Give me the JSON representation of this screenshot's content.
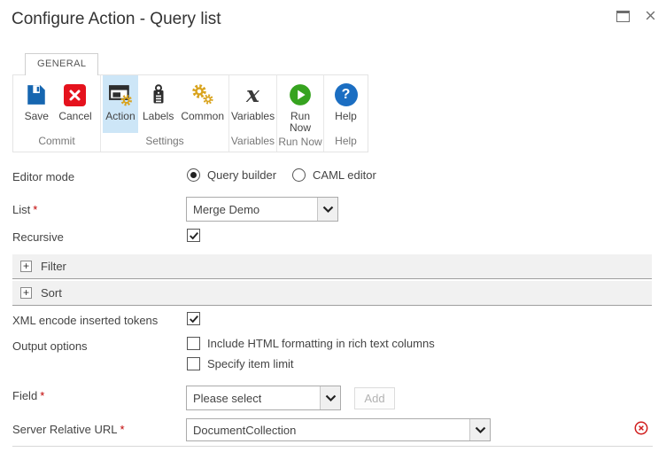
{
  "window": {
    "title": "Configure Action - Query list"
  },
  "tab": {
    "label": "GENERAL"
  },
  "ribbon": {
    "groups": [
      {
        "label": "Commit",
        "buttons": [
          {
            "label": "Save"
          },
          {
            "label": "Cancel"
          }
        ]
      },
      {
        "label": "Settings",
        "buttons": [
          {
            "label": "Action",
            "selected": true
          },
          {
            "label": "Labels"
          },
          {
            "label": "Common"
          }
        ]
      },
      {
        "label": "Variables",
        "buttons": [
          {
            "label": "Variables"
          }
        ]
      },
      {
        "label": "Run Now",
        "buttons": [
          {
            "label": "Run Now"
          }
        ]
      },
      {
        "label": "Help",
        "buttons": [
          {
            "label": "Help"
          }
        ]
      }
    ]
  },
  "icons": {
    "variables_glyph": "x",
    "help_glyph": "?",
    "expand_glyph": "+"
  },
  "form": {
    "required_marker": "*",
    "editor_mode": {
      "label": "Editor mode",
      "options": [
        {
          "label": "Query builder",
          "selected": true
        },
        {
          "label": "CAML editor",
          "selected": false
        }
      ]
    },
    "list": {
      "label": "List",
      "required": true,
      "value": "Merge Demo"
    },
    "recursive": {
      "label": "Recursive",
      "checked": true
    },
    "sections": [
      {
        "label": "Filter",
        "expanded": false
      },
      {
        "label": "Sort",
        "expanded": false
      }
    ],
    "xml_encode": {
      "label": "XML encode inserted tokens",
      "checked": true
    },
    "output_options": {
      "label": "Output options",
      "checkboxes": [
        {
          "label": "Include HTML formatting in rich text columns",
          "checked": false
        },
        {
          "label": "Specify item limit",
          "checked": false
        }
      ]
    },
    "field": {
      "label": "Field",
      "required": true,
      "value": "Please select",
      "add_button": "Add",
      "add_enabled": false
    },
    "server_relative_url": {
      "label": "Server Relative URL",
      "required": true,
      "value": "DocumentCollection",
      "has_error": true
    }
  },
  "colors": {
    "accent_blue": "#1666b0",
    "cancel_red": "#e5121d",
    "run_green": "#36a31f",
    "help_blue": "#1b6ec2",
    "gear_gold": "#d9a31d",
    "selected_bg": "#cde6f7",
    "required_red": "#c00000",
    "error_red": "#d01c1c"
  }
}
